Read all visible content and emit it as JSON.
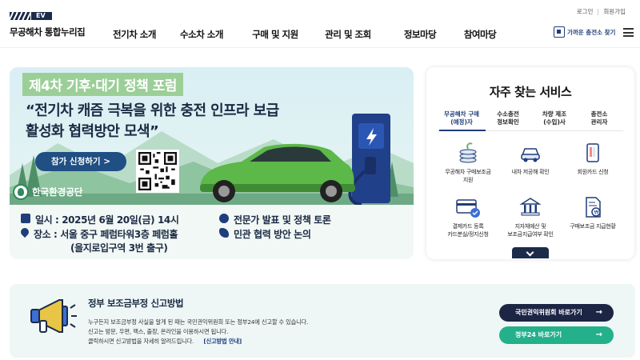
{
  "header": {
    "logo_badge": "EV",
    "logo_text": "무공해차 통합누리집",
    "util_links": [
      "로그인",
      "회원가입"
    ],
    "nav": [
      "전기차 소개",
      "수소차 소개",
      "구매 및 지원",
      "관리 및 조회",
      "정보마당",
      "참여마당"
    ],
    "charger_find": "가까운 충전소 찾기"
  },
  "banner": {
    "tag": "제4차 기후·대기 정책 포럼",
    "title_line1": "“전기차 캐즘 극복을 위한 충전 인프라 보급",
    "title_line2": "활성화 협력방안 모색”",
    "apply_button": "참가 신청하기 >",
    "org": "한국환경공단",
    "date": "일시 : 2025년 6월 20일(금) 14시",
    "place_line1": "장소 : 서울 중구 페럼타워3층 페럼홀",
    "place_line2": "(을지로입구역 3번 출구)",
    "topic1": "전문가 발표 및 정책 토론",
    "topic2": "민관 협력 방안 논의"
  },
  "services": {
    "title": "자주 찾는 서비스",
    "tabs": [
      {
        "line1": "무공해차 구매",
        "line2": "(예정)자"
      },
      {
        "line1": "수소충전",
        "line2": "정보확인"
      },
      {
        "line1": "차량 제조",
        "line2": "(수입)사"
      },
      {
        "line1": "충전소",
        "line2": "관리자"
      }
    ],
    "items": [
      {
        "line1": "무공해차 구매보조금",
        "line2": "지원",
        "icon": "coins-icon"
      },
      {
        "line1": "내차 저공해 확인",
        "line2": "",
        "icon": "car-icon"
      },
      {
        "line1": "회원카드 신청",
        "line2": "",
        "icon": "member-card-icon"
      },
      {
        "line1": "결제카드 등록",
        "line2": "카드분실/정지신청",
        "icon": "credit-card-icon"
      },
      {
        "line1": "지자체예산 및",
        "line2": "보조금지급여부 확인",
        "icon": "government-building-icon"
      },
      {
        "line1": "구매보조금 지급현황",
        "line2": "",
        "icon": "payment-document-icon"
      }
    ]
  },
  "report": {
    "title": "정부 보조금부정 신고방법",
    "desc_line1": "누구든지 보조금부정 사실을 알게 된 때는 국민권익위원회 또는 정부24에 신고할 수 있습니다.",
    "desc_line2": "신고는 방문, 우편, 팩스, 출장, 온라인을 이용하시면 됩니다.",
    "desc_line3": "클릭하시면 신고방법을 자세히 알려드립니다.",
    "guide_link": "[신고방법 안내]",
    "btn_acrc": "국민권익위원회 바로가기",
    "btn_gov24": "정부24 바로가기",
    "arrow": "→"
  },
  "colors": {
    "navy": "#1c2b4a",
    "accent_blue": "#1f3d7a",
    "green_button": "#23b08a",
    "banner_tag_green": "#9ccf97"
  }
}
